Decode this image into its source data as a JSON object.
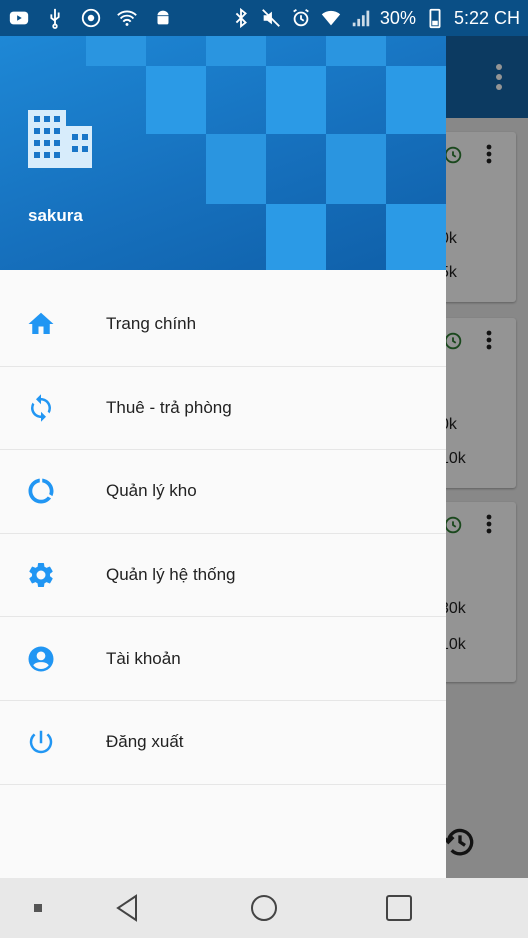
{
  "status_bar": {
    "battery": "30%",
    "time": "5:22 CH",
    "icons": [
      "youtube-icon",
      "usb-icon",
      "chrome-icon",
      "wifi-icon",
      "android-icon",
      "bluetooth-icon",
      "mute-icon",
      "alarm-icon",
      "wifi-icon",
      "signal-icon",
      "battery-icon"
    ]
  },
  "drawer": {
    "header": {
      "icon": "building-icon",
      "title": "sakura",
      "color": "#1976c8"
    },
    "items": [
      {
        "label": "Trang chính",
        "icon": "home-icon"
      },
      {
        "label": "Thuê - trả phòng",
        "icon": "sync-icon"
      },
      {
        "label": "Quản lý kho",
        "icon": "donut-icon"
      },
      {
        "label": "Quản lý hệ thống",
        "icon": "gear-icon"
      },
      {
        "label": "Tài khoản",
        "icon": "account-icon"
      },
      {
        "label": "Đăng xuất",
        "icon": "power-icon"
      }
    ],
    "accent": "#2196f3"
  },
  "background": {
    "cards": [
      {
        "line1": "0k",
        "line2": "5k"
      },
      {
        "line1": "0k",
        "line2": "10k"
      },
      {
        "line1": "30k",
        "line2": "10k"
      }
    ]
  },
  "nav_bar": {
    "buttons": [
      "recents-dot-icon",
      "back-icon",
      "home-circle-icon",
      "overview-square-icon"
    ]
  }
}
